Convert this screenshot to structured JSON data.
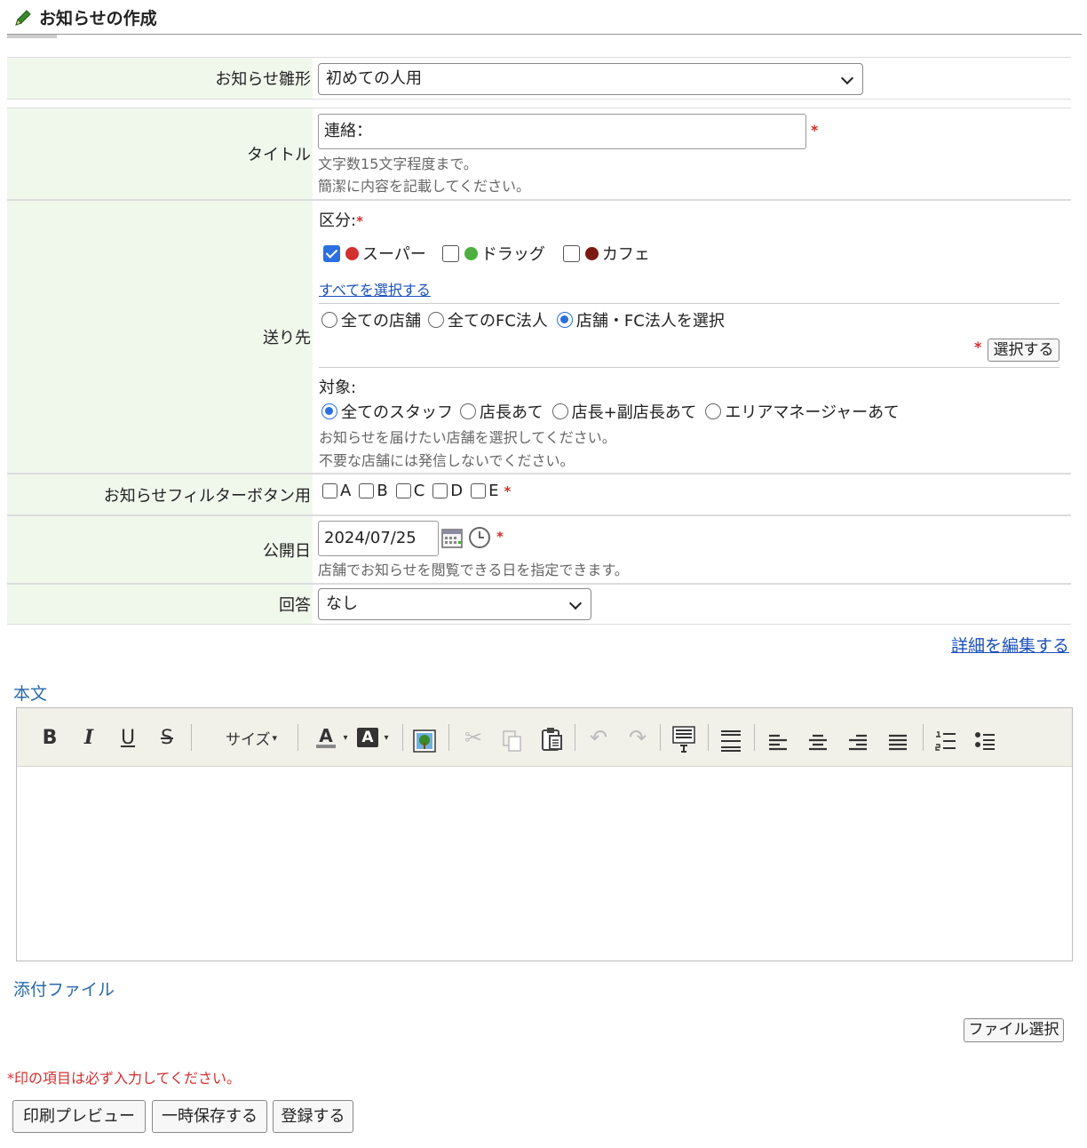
{
  "page": {
    "title": "お知らせの作成"
  },
  "template_row": {
    "label": "お知らせ雛形",
    "selected": "初めての人用"
  },
  "title_row": {
    "label": "タイトル",
    "value": "連絡：",
    "required_mark": "*",
    "hint1": "文字数15文字程度まで。",
    "hint2": "簡潔に内容を記載してください。"
  },
  "destination_row": {
    "label": "送り先",
    "category_label": "区分:",
    "required_mark": "*",
    "categories": [
      {
        "label": "スーパー",
        "checked": true,
        "color": "#d32f2f"
      },
      {
        "label": "ドラッグ",
        "checked": false,
        "color": "#4caf3f"
      },
      {
        "label": "カフェ",
        "checked": false,
        "color": "#7b1a12"
      }
    ],
    "select_all_link": "すべてを選択する",
    "scope_options": [
      {
        "label": "全ての店舗",
        "selected": false
      },
      {
        "label": "全てのFC法人",
        "selected": false
      },
      {
        "label": "店舗・FC法人を選択",
        "selected": true
      }
    ],
    "select_button": "選択する",
    "target_label": "対象:",
    "target_options": [
      {
        "label": "全てのスタッフ",
        "selected": true
      },
      {
        "label": "店長あて",
        "selected": false
      },
      {
        "label": "店長+副店長あて",
        "selected": false
      },
      {
        "label": "エリアマネージャーあて",
        "selected": false
      }
    ],
    "hint1": "お知らせを届けたい店舗を選択してください。",
    "hint2": "不要な店舗には発信しないでください。"
  },
  "filter_row": {
    "label": "お知らせフィルターボタン用",
    "options": [
      "A",
      "B",
      "C",
      "D",
      "E"
    ],
    "required_mark": "*"
  },
  "publish_row": {
    "label": "公開日",
    "date": "2024/07/25",
    "required_mark": "*",
    "hint": "店舗でお知らせを閲覧できる日を指定できます。"
  },
  "answer_row": {
    "label": "回答",
    "selected": "なし"
  },
  "edit_details_link": "詳細を編集する",
  "body_section": {
    "heading": "本文",
    "size_label": "サイズ"
  },
  "attachment_section": {
    "heading": "添付ファイル",
    "file_button": "ファイル選択"
  },
  "required_note": "*印の項目は必ず入力してください。",
  "actions": {
    "print_preview": "印刷プレビュー",
    "save_draft": "一時保存する",
    "register": "登録する"
  },
  "colors": {
    "label_bg": "#f0f8ec",
    "link": "#1a4fbd",
    "section_heading": "#2a6aa8",
    "required": "#d32f2f",
    "radio_checked": "#2b6fe0"
  }
}
